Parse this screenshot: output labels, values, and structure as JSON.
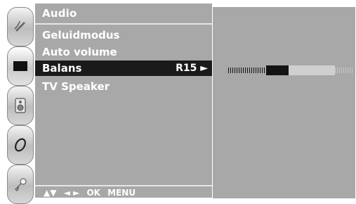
{
  "sidebar": {
    "icons": [
      {
        "name": "satellite-icon"
      },
      {
        "name": "picture-icon"
      },
      {
        "name": "speaker-icon"
      },
      {
        "name": "clock-icon"
      },
      {
        "name": "key-icon"
      }
    ]
  },
  "menu": {
    "title": "Audio",
    "items": [
      {
        "label": "Geluidmodus",
        "value": ""
      },
      {
        "label": "Auto volume",
        "value": ""
      },
      {
        "label": "Balans",
        "value": "R15 ►",
        "selected": true
      },
      {
        "label": "TV Speaker",
        "value": ""
      }
    ],
    "footer": {
      "updown": "▲▼",
      "leftright": "◄ ►",
      "ok": "OK",
      "menu": "MENU"
    }
  },
  "balance": {
    "level_fraction": 0.65
  },
  "colors": {
    "panel": "#a8a8a8",
    "highlight": "#1a1a1a",
    "text": "#ffffff"
  }
}
